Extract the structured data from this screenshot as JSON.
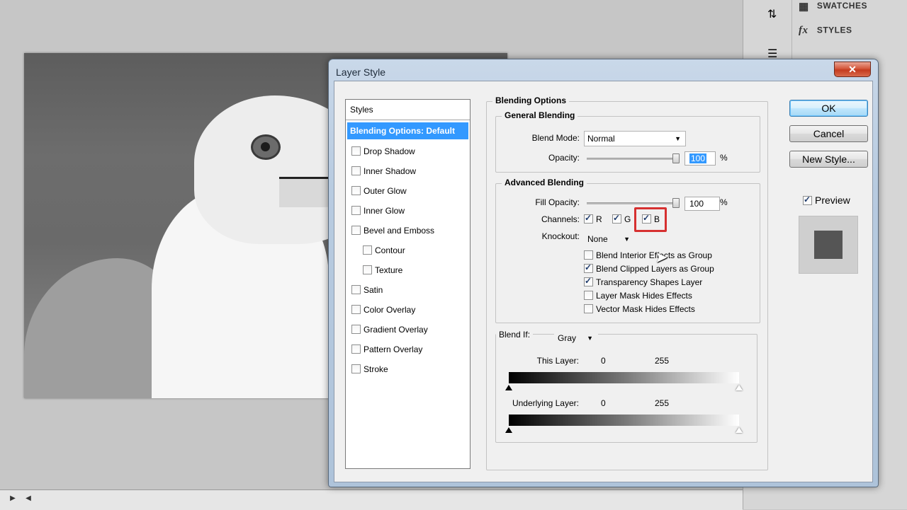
{
  "workspace": {
    "panel": {
      "swatches_label": "SWATCHES",
      "styles_label": "STYLES"
    }
  },
  "dialog": {
    "title": "Layer Style",
    "close_glyph": "✕",
    "styles_header": "Styles",
    "styles": [
      {
        "label": "Blending Options: Default",
        "selected": true,
        "checkbox": false
      },
      {
        "label": "Drop Shadow",
        "checked": false
      },
      {
        "label": "Inner Shadow",
        "checked": false
      },
      {
        "label": "Outer Glow",
        "checked": false
      },
      {
        "label": "Inner Glow",
        "checked": false
      },
      {
        "label": "Bevel and Emboss",
        "checked": false
      },
      {
        "label": "Contour",
        "checked": false,
        "sub": true
      },
      {
        "label": "Texture",
        "checked": false,
        "sub": true
      },
      {
        "label": "Satin",
        "checked": false
      },
      {
        "label": "Color Overlay",
        "checked": false
      },
      {
        "label": "Gradient Overlay",
        "checked": false
      },
      {
        "label": "Pattern Overlay",
        "checked": false
      },
      {
        "label": "Stroke",
        "checked": false
      }
    ],
    "blending_options": {
      "title": "Blending Options",
      "general": {
        "title": "General Blending",
        "blend_mode_label": "Blend Mode:",
        "blend_mode_value": "Normal",
        "opacity_label": "Opacity:",
        "opacity_value": "100",
        "opacity_unit": "%"
      },
      "advanced": {
        "title": "Advanced Blending",
        "fill_opacity_label": "Fill Opacity:",
        "fill_opacity_value": "100",
        "fill_opacity_unit": "%",
        "channels_label": "Channels:",
        "channel_r": "R",
        "channel_g": "G",
        "channel_b": "B",
        "knockout_label": "Knockout:",
        "knockout_value": "None",
        "options": [
          {
            "label": "Blend Interior Effects as Group",
            "checked": false
          },
          {
            "label": "Blend Clipped Layers as Group",
            "checked": true
          },
          {
            "label": "Transparency Shapes Layer",
            "checked": true
          },
          {
            "label": "Layer Mask Hides Effects",
            "checked": false
          },
          {
            "label": "Vector Mask Hides Effects",
            "checked": false
          }
        ]
      },
      "blend_if": {
        "label": "Blend If:",
        "value": "Gray",
        "this_layer_label": "This Layer:",
        "this_layer_low": "0",
        "this_layer_high": "255",
        "underlying_label": "Underlying Layer:",
        "underlying_low": "0",
        "underlying_high": "255"
      }
    },
    "buttons": {
      "ok": "OK",
      "cancel": "Cancel",
      "new_style": "New Style...",
      "preview_label": "Preview"
    }
  }
}
